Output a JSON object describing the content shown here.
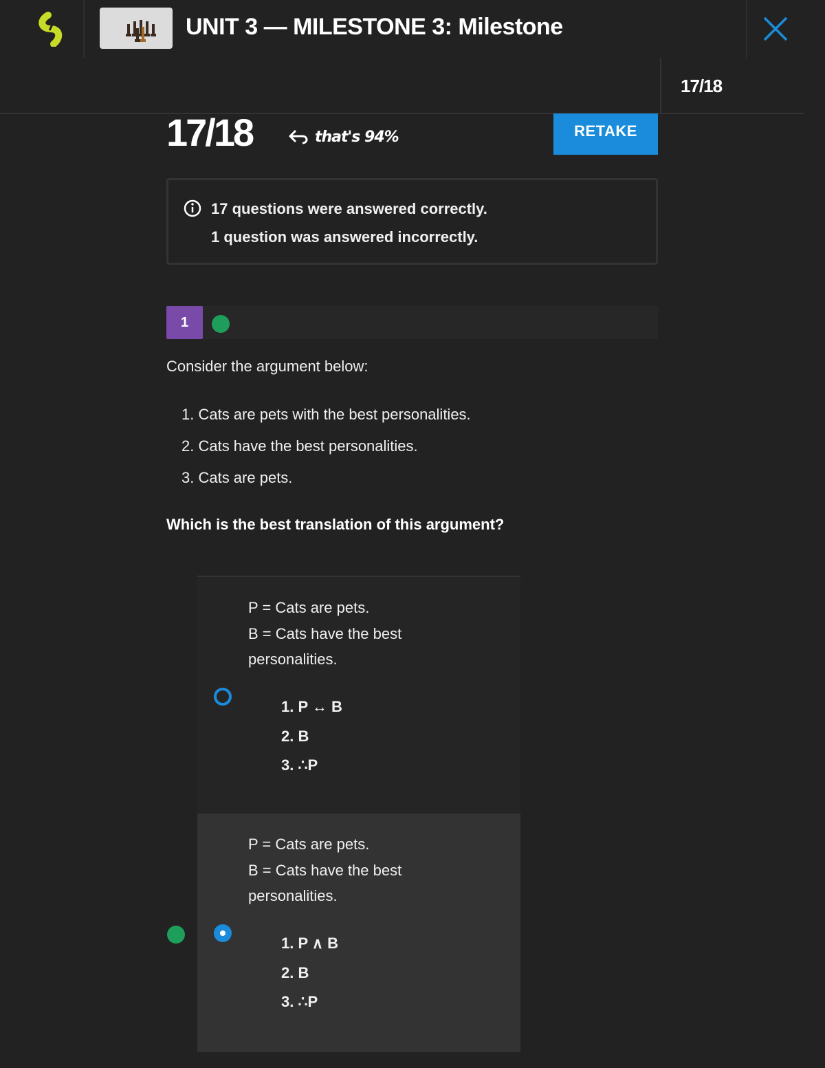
{
  "header": {
    "title": "UNIT 3 — MILESTONE 3: Milestone",
    "score": "17/18",
    "logo_color": "#c6dc27"
  },
  "results": {
    "score": "17/18",
    "percent_label": "that's 94%",
    "retake_label": "RETAKE",
    "summary_correct": "17 questions were answered correctly.",
    "summary_incorrect": "1 question was answered incorrectly."
  },
  "question": {
    "number": "1",
    "status": "correct",
    "prompt": "Consider the argument below:",
    "premises": [
      "1. Cats are pets with the best personalities.",
      "2. Cats have the best personalities.",
      "3. Cats are pets."
    ],
    "ask": "Which is the best translation of this argument?",
    "options": [
      {
        "key_lines": [
          "P = Cats are pets.",
          "B = Cats have the best",
          "personalities."
        ],
        "steps": [
          "1. P ↔ B",
          "2. B",
          "3. ∴P"
        ],
        "selected": false
      },
      {
        "key_lines": [
          "P = Cats are pets.",
          "B = Cats have the best",
          "personalities."
        ],
        "steps": [
          "1. P ∧ B",
          "2. B",
          "3. ∴P"
        ],
        "selected": true,
        "correct": true
      }
    ]
  },
  "colors": {
    "accent": "#1a8cdb",
    "correct": "#1e9e5a",
    "question_badge": "#7a4aa8"
  }
}
